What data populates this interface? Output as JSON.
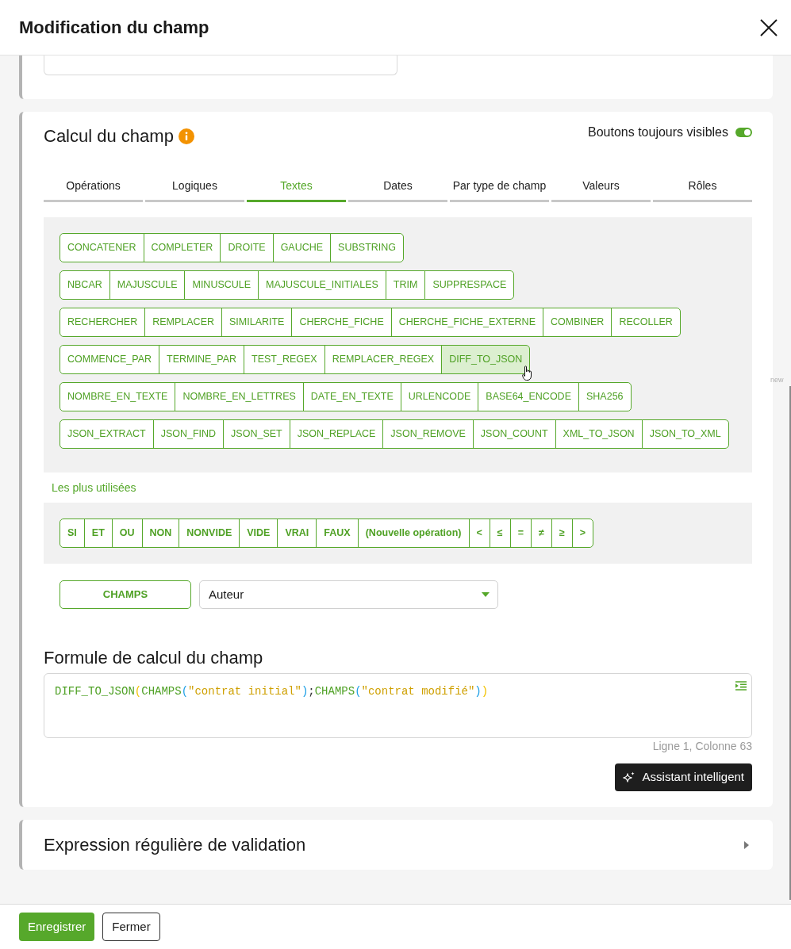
{
  "dialog": {
    "title": "Modification du champ"
  },
  "side_label": "new",
  "calculation": {
    "title": "Calcul du champ",
    "always_visible": {
      "label": "Boutons toujours visibles",
      "on": true
    },
    "tabs": [
      {
        "label": "Opérations",
        "selected": false
      },
      {
        "label": "Logiques",
        "selected": false
      },
      {
        "label": "Textes",
        "selected": true
      },
      {
        "label": "Dates",
        "selected": false
      },
      {
        "label": "Par type de champ",
        "selected": false
      },
      {
        "label": "Valeurs",
        "selected": false
      },
      {
        "label": "Rôles",
        "selected": false
      }
    ],
    "function_groups": [
      [
        {
          "label": "CONCATENER",
          "selected": false
        },
        {
          "label": "COMPLETER",
          "selected": false
        },
        {
          "label": "DROITE",
          "selected": false
        },
        {
          "label": "GAUCHE",
          "selected": false
        },
        {
          "label": "SUBSTRING",
          "selected": false
        }
      ],
      [
        {
          "label": "NBCAR",
          "selected": false
        },
        {
          "label": "MAJUSCULE",
          "selected": false
        },
        {
          "label": "MINUSCULE",
          "selected": false
        },
        {
          "label": "MAJUSCULE_INITIALES",
          "selected": false
        },
        {
          "label": "TRIM",
          "selected": false
        },
        {
          "label": "SUPPRESPACE",
          "selected": false
        }
      ],
      [
        {
          "label": "RECHERCHER",
          "selected": false
        },
        {
          "label": "REMPLACER",
          "selected": false
        },
        {
          "label": "SIMILARITE",
          "selected": false
        },
        {
          "label": "CHERCHE_FICHE",
          "selected": false
        },
        {
          "label": "CHERCHE_FICHE_EXTERNE",
          "selected": false
        },
        {
          "label": "COMBINER",
          "selected": false
        },
        {
          "label": "RECOLLER",
          "selected": false
        }
      ],
      [
        {
          "label": "COMMENCE_PAR",
          "selected": false
        },
        {
          "label": "TERMINE_PAR",
          "selected": false
        },
        {
          "label": "TEST_REGEX",
          "selected": false
        },
        {
          "label": "REMPLACER_REGEX",
          "selected": false
        },
        {
          "label": "DIFF_TO_JSON",
          "selected": true
        }
      ],
      [
        {
          "label": "NOMBRE_EN_TEXTE",
          "selected": false
        },
        {
          "label": "NOMBRE_EN_LETTRES",
          "selected": false
        },
        {
          "label": "DATE_EN_TEXTE",
          "selected": false
        },
        {
          "label": "URLENCODE",
          "selected": false
        },
        {
          "label": "BASE64_ENCODE",
          "selected": false
        },
        {
          "label": "SHA256",
          "selected": false
        }
      ],
      [
        {
          "label": "JSON_EXTRACT",
          "selected": false
        },
        {
          "label": "JSON_FIND",
          "selected": false
        },
        {
          "label": "JSON_SET",
          "selected": false
        },
        {
          "label": "JSON_REPLACE",
          "selected": false
        },
        {
          "label": "JSON_REMOVE",
          "selected": false
        },
        {
          "label": "JSON_COUNT",
          "selected": false
        },
        {
          "label": "XML_TO_JSON",
          "selected": false
        },
        {
          "label": "JSON_TO_XML",
          "selected": false
        }
      ]
    ],
    "most_used_label": "Les plus utilisées",
    "most_used": [
      "SI",
      "ET",
      "OU",
      "NON",
      "NONVIDE",
      "VIDE",
      "VRAI",
      "FAUX",
      "(Nouvelle opération)",
      "<",
      "≤",
      "=",
      "≠",
      "≥",
      ">"
    ],
    "fields": {
      "button": "CHAMPS",
      "select_value": "Auteur"
    },
    "formula": {
      "title": "Formule de calcul du champ",
      "tokens": [
        {
          "text": "DIFF_TO_JSON",
          "kind": "function"
        },
        {
          "text": "(",
          "kind": "bracket1"
        },
        {
          "text": "CHAMPS",
          "kind": "function"
        },
        {
          "text": "(",
          "kind": "bracket2"
        },
        {
          "text": "\"contrat initial\"",
          "kind": "string"
        },
        {
          "text": ")",
          "kind": "bracket2"
        },
        {
          "text": ";",
          "kind": "punctuation"
        },
        {
          "text": "CHAMPS",
          "kind": "function"
        },
        {
          "text": "(",
          "kind": "bracket2"
        },
        {
          "text": "\"contrat modifié\"",
          "kind": "string"
        },
        {
          "text": ")",
          "kind": "bracket2"
        },
        {
          "text": ")",
          "kind": "bracket1"
        }
      ],
      "cursor_position": "Ligne 1, Colonne 63"
    },
    "assistant_button": "Assistant intelligent"
  },
  "validation": {
    "title": "Expression régulière de validation",
    "expanded": false
  },
  "footer": {
    "buttons": [
      {
        "label": "Enregistrer",
        "kind": "primary"
      },
      {
        "label": "Fermer",
        "kind": "secondary"
      }
    ]
  }
}
